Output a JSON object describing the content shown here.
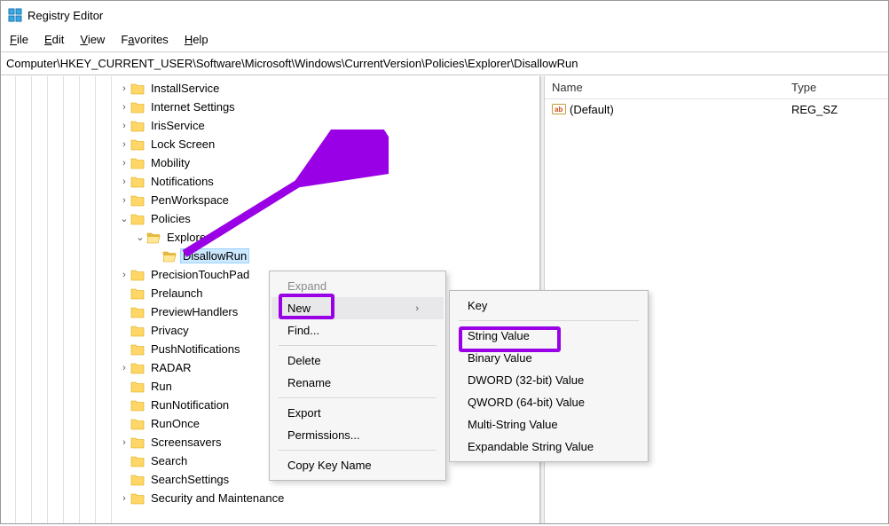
{
  "title": "Registry Editor",
  "menubar": [
    "File",
    "Edit",
    "View",
    "Favorites",
    "Help"
  ],
  "path": "Computer\\HKEY_CURRENT_USER\\Software\\Microsoft\\Windows\\CurrentVersion\\Policies\\Explorer\\DisallowRun",
  "list": {
    "headers": {
      "name": "Name",
      "type": "Type"
    },
    "rows": [
      {
        "name": "(Default)",
        "type": "REG_SZ"
      }
    ]
  },
  "tree": [
    {
      "label": "InstallService",
      "expandable": true,
      "indent": 132
    },
    {
      "label": "Internet Settings",
      "expandable": true,
      "indent": 132
    },
    {
      "label": "IrisService",
      "expandable": true,
      "indent": 132
    },
    {
      "label": "Lock Screen",
      "expandable": true,
      "indent": 132
    },
    {
      "label": "Mobility",
      "expandable": true,
      "indent": 132
    },
    {
      "label": "Notifications",
      "expandable": true,
      "indent": 132
    },
    {
      "label": "PenWorkspace",
      "expandable": true,
      "indent": 132
    },
    {
      "label": "Policies",
      "expandable": true,
      "expanded": true,
      "indent": 132
    },
    {
      "label": "Explorer",
      "expandable": true,
      "expanded": true,
      "open": true,
      "indent": 150
    },
    {
      "label": "DisallowRun",
      "expandable": false,
      "open": true,
      "selected": true,
      "indent": 168
    },
    {
      "label": "PrecisionTouchPad",
      "expandable": true,
      "indent": 132
    },
    {
      "label": "Prelaunch",
      "expandable": false,
      "indent": 132
    },
    {
      "label": "PreviewHandlers",
      "expandable": false,
      "indent": 132
    },
    {
      "label": "Privacy",
      "expandable": false,
      "indent": 132
    },
    {
      "label": "PushNotifications",
      "expandable": false,
      "indent": 132
    },
    {
      "label": "RADAR",
      "expandable": true,
      "indent": 132
    },
    {
      "label": "Run",
      "expandable": false,
      "indent": 132
    },
    {
      "label": "RunNotification",
      "expandable": false,
      "indent": 132
    },
    {
      "label": "RunOnce",
      "expandable": false,
      "indent": 132
    },
    {
      "label": "Screensavers",
      "expandable": true,
      "indent": 132
    },
    {
      "label": "Search",
      "expandable": false,
      "indent": 132
    },
    {
      "label": "SearchSettings",
      "expandable": false,
      "indent": 132
    },
    {
      "label": "Security and Maintenance",
      "expandable": true,
      "indent": 132
    }
  ],
  "ctx1": {
    "items": [
      {
        "label": "Expand",
        "disabled": true
      },
      {
        "label": "New",
        "hover": true,
        "submenu": true
      },
      {
        "label": "Find...",
        "sepAfter": true
      },
      {
        "label": "Delete"
      },
      {
        "label": "Rename",
        "sepAfter": true
      },
      {
        "label": "Export"
      },
      {
        "label": "Permissions...",
        "sepAfter": true
      },
      {
        "label": "Copy Key Name"
      }
    ]
  },
  "ctx2": {
    "items": [
      {
        "label": "Key",
        "sepAfter": true
      },
      {
        "label": "String Value"
      },
      {
        "label": "Binary Value"
      },
      {
        "label": "DWORD (32-bit) Value"
      },
      {
        "label": "QWORD (64-bit) Value"
      },
      {
        "label": "Multi-String Value"
      },
      {
        "label": "Expandable String Value"
      }
    ]
  }
}
